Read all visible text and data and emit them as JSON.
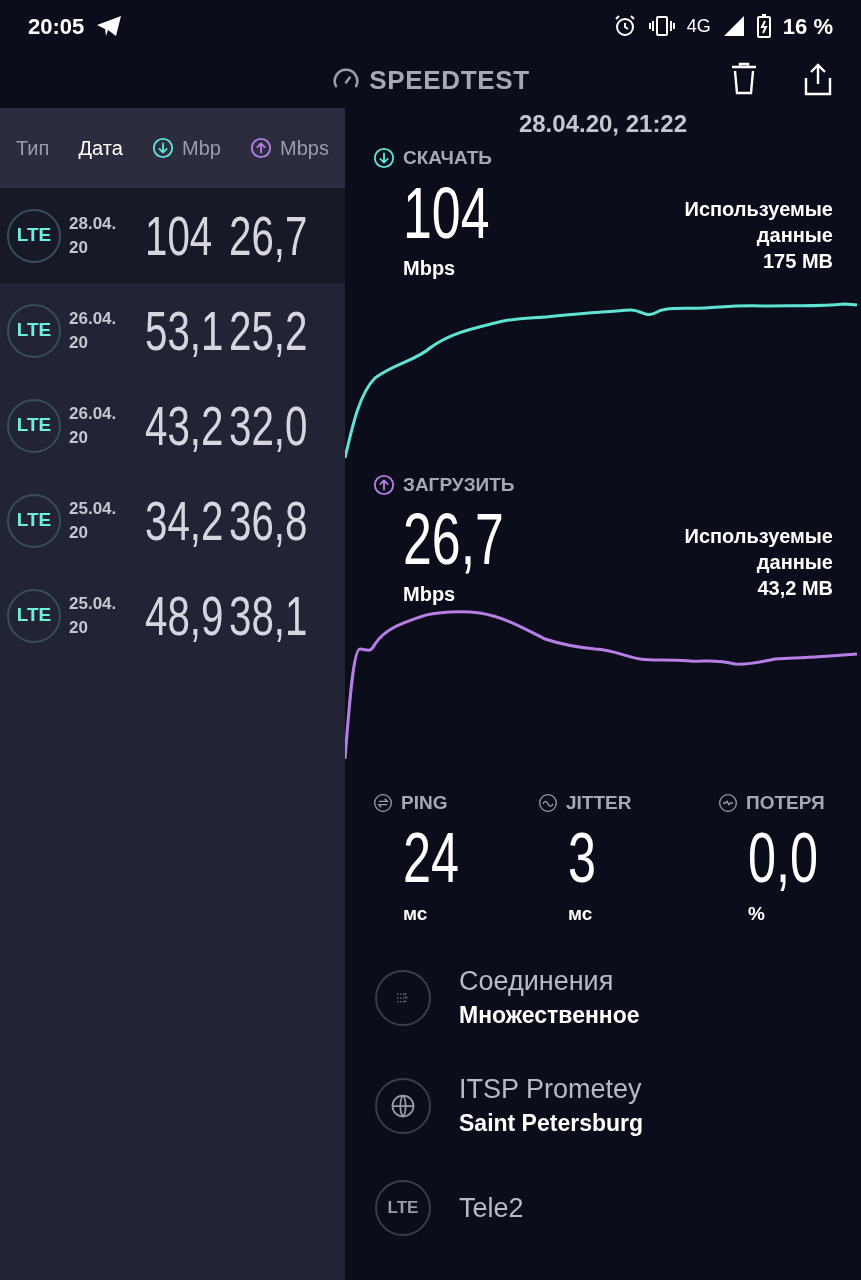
{
  "status_bar": {
    "time": "20:05",
    "network": "4G",
    "battery": "16 %"
  },
  "header": {
    "title": "SPEEDTEST"
  },
  "history": {
    "columns": [
      {
        "label": "Тип",
        "kind": "plain",
        "selected": false
      },
      {
        "label": "Дата",
        "kind": "plain",
        "selected": true
      },
      {
        "label": "Mbp",
        "kind": "download",
        "selected": false
      },
      {
        "label": "Mbps",
        "kind": "upload",
        "selected": false
      }
    ],
    "rows": [
      {
        "type": "LTE",
        "date": [
          "28.04.",
          "20"
        ],
        "download": "104",
        "upload": "26,7",
        "selected": true
      },
      {
        "type": "LTE",
        "date": [
          "26.04.",
          "20"
        ],
        "download": "53,1",
        "upload": "25,2",
        "selected": false
      },
      {
        "type": "LTE",
        "date": [
          "26.04.",
          "20"
        ],
        "download": "43,2",
        "upload": "32,0",
        "selected": false
      },
      {
        "type": "LTE",
        "date": [
          "25.04.",
          "20"
        ],
        "download": "34,2",
        "upload": "36,8",
        "selected": false
      },
      {
        "type": "LTE",
        "date": [
          "25.04.",
          "20"
        ],
        "download": "48,9",
        "upload": "38,1",
        "selected": false
      }
    ]
  },
  "result": {
    "timestamp": "28.04.20, 21:22",
    "tests": [
      {
        "kind": "download",
        "label": "СКАЧАТЬ",
        "value": "104",
        "unit": "Mbps",
        "data_label": "Используемые данные",
        "data_value": "175 MB"
      },
      {
        "kind": "upload",
        "label": "ЗАГРУЗИТЬ",
        "value": "26,7",
        "unit": "Mbps",
        "data_label": "Используемые данные",
        "data_value": "43,2 MB"
      }
    ],
    "metrics": [
      {
        "kind": "ping",
        "label": "PING",
        "value": "24",
        "unit": "мс"
      },
      {
        "kind": "jitter",
        "label": "JITTER",
        "value": "3",
        "unit": "мс"
      },
      {
        "kind": "loss",
        "label": "ПОТЕРЯ",
        "value": "0,0",
        "unit": "%"
      }
    ],
    "info": [
      {
        "kind": "connections",
        "title": "Соединения",
        "subtitle": "Множественное"
      },
      {
        "kind": "server",
        "title": "ITSP Prometey",
        "subtitle": "Saint Petersburg"
      },
      {
        "kind": "carrier",
        "badge": "LTE",
        "title": "Tele2"
      }
    ]
  }
}
